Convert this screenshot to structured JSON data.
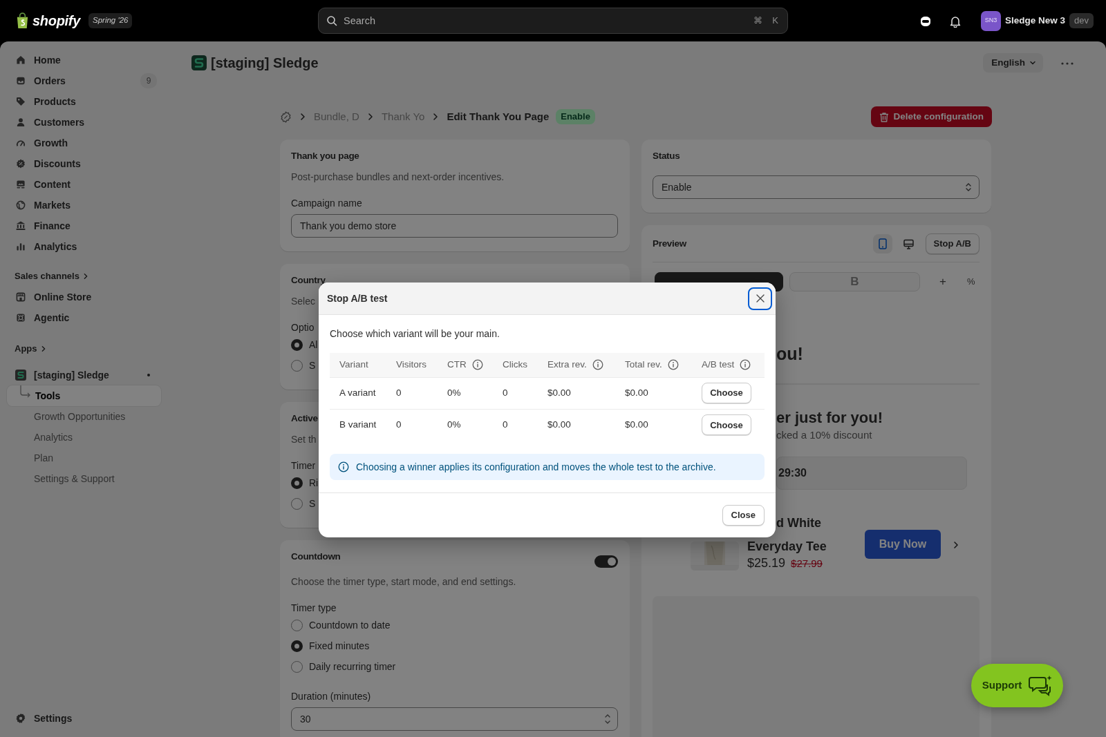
{
  "topbar": {
    "brand": "shopify",
    "edition": "Spring '26",
    "search": {
      "placeholder": "Search",
      "keys": [
        "⌘",
        "K"
      ]
    },
    "account": {
      "initials": "SN3",
      "name": "Sledge New 3",
      "tag": "dev"
    }
  },
  "sidebar": {
    "items": [
      {
        "label": "Home",
        "selected": false
      },
      {
        "label": "Orders",
        "count": "9",
        "selected": false
      },
      {
        "label": "Products",
        "selected": false
      },
      {
        "label": "Customers",
        "selected": false
      },
      {
        "label": "Growth",
        "selected": false
      },
      {
        "label": "Discounts",
        "selected": false
      },
      {
        "label": "Content",
        "selected": false
      },
      {
        "label": "Markets",
        "selected": false
      },
      {
        "label": "Finance",
        "selected": false
      },
      {
        "label": "Analytics",
        "selected": false
      }
    ],
    "sales_channels": {
      "title": "Sales channels",
      "items": [
        {
          "label": "Online Store",
          "selected": false
        },
        {
          "label": "Agentic",
          "selected": false
        }
      ]
    },
    "apps": {
      "title": "Apps",
      "app": {
        "label": "[staging] Sledge",
        "children": [
          {
            "label": "Tools",
            "selected": true
          },
          {
            "label": "Growth Opportunities",
            "selected": false
          },
          {
            "label": "Analytics",
            "selected": false
          },
          {
            "label": "Plan",
            "selected": false
          },
          {
            "label": "Settings & Support",
            "selected": false
          }
        ]
      }
    },
    "settings": "Settings"
  },
  "app_header": {
    "title": "[staging] Sledge",
    "language": "English"
  },
  "breadcrumb": {
    "items": [
      "Bundle, D",
      "Thank Yo"
    ],
    "current": "Edit Thank You Page",
    "badge": "Enable",
    "action": "Delete configuration"
  },
  "left_cards": [
    {
      "title": "Thank you page",
      "description": "Post-purchase bundles and next-order incentives.",
      "field": {
        "label": "Campaign name",
        "value": "Thank you demo store"
      }
    },
    {
      "title": "Country",
      "description": "Selec",
      "options_label": "Optio",
      "options": [
        {
          "label": "Al",
          "selected": true
        },
        {
          "label": "S",
          "selected": false
        }
      ]
    },
    {
      "title": "Active",
      "description": "Set th",
      "options_label": "Timer",
      "options": [
        {
          "label": "Ri",
          "selected": true
        },
        {
          "label": "S",
          "selected": false
        }
      ]
    },
    {
      "title": "Countdown",
      "description": "Choose the timer type, start mode, and end settings.",
      "on": true,
      "options_label": "Timer type",
      "options": [
        {
          "label": "Countdown to date",
          "selected": false
        },
        {
          "label": "Fixed minutes",
          "selected": true
        },
        {
          "label": "Daily recurring timer",
          "selected": false
        }
      ],
      "field": {
        "label": "Duration (minutes)",
        "value": "30"
      }
    }
  ],
  "status_card": {
    "title": "Status",
    "value": "Enable"
  },
  "preview_card": {
    "title": "Preview",
    "devices": [
      {
        "selected": true
      },
      {
        "selected": false
      }
    ],
    "stop_button": "Stop A/B",
    "variant_tabs": [
      {
        "selected": true
      },
      {
        "label": "B",
        "selected": false
      }
    ],
    "add": "+",
    "split": "%",
    "heading": "ou!",
    "offer_title": "er just for you!",
    "offer_text": "cked a 10% discount",
    "timer": "29:30",
    "product": {
      "title_lines": [
        "d White",
        "Everyday Tee"
      ],
      "price": "$25.19",
      "compare_price": "$27.99",
      "button": "Buy Now"
    }
  },
  "support_button": "Support",
  "modal": {
    "title": "Stop A/B test",
    "intro": "Choose which variant will be your main.",
    "columns": [
      {
        "label": "Variant",
        "info": false
      },
      {
        "label": "Visitors",
        "info": false
      },
      {
        "label": "CTR",
        "info": true
      },
      {
        "label": "Clicks",
        "info": false
      },
      {
        "label": "Extra rev.",
        "info": true
      },
      {
        "label": "Total rev.",
        "info": true
      },
      {
        "label": "A/B test",
        "info": true
      }
    ],
    "rows": [
      {
        "cells": [
          "A variant",
          "0",
          "0%",
          "0",
          "$0.00",
          "$0.00"
        ],
        "action": "Choose"
      },
      {
        "cells": [
          "B variant",
          "0",
          "0%",
          "0",
          "$0.00",
          "$0.00"
        ],
        "action": "Choose"
      }
    ],
    "notice": "Choosing a winner applies its configuration and moves the whole test to the archive.",
    "close": "Close"
  }
}
